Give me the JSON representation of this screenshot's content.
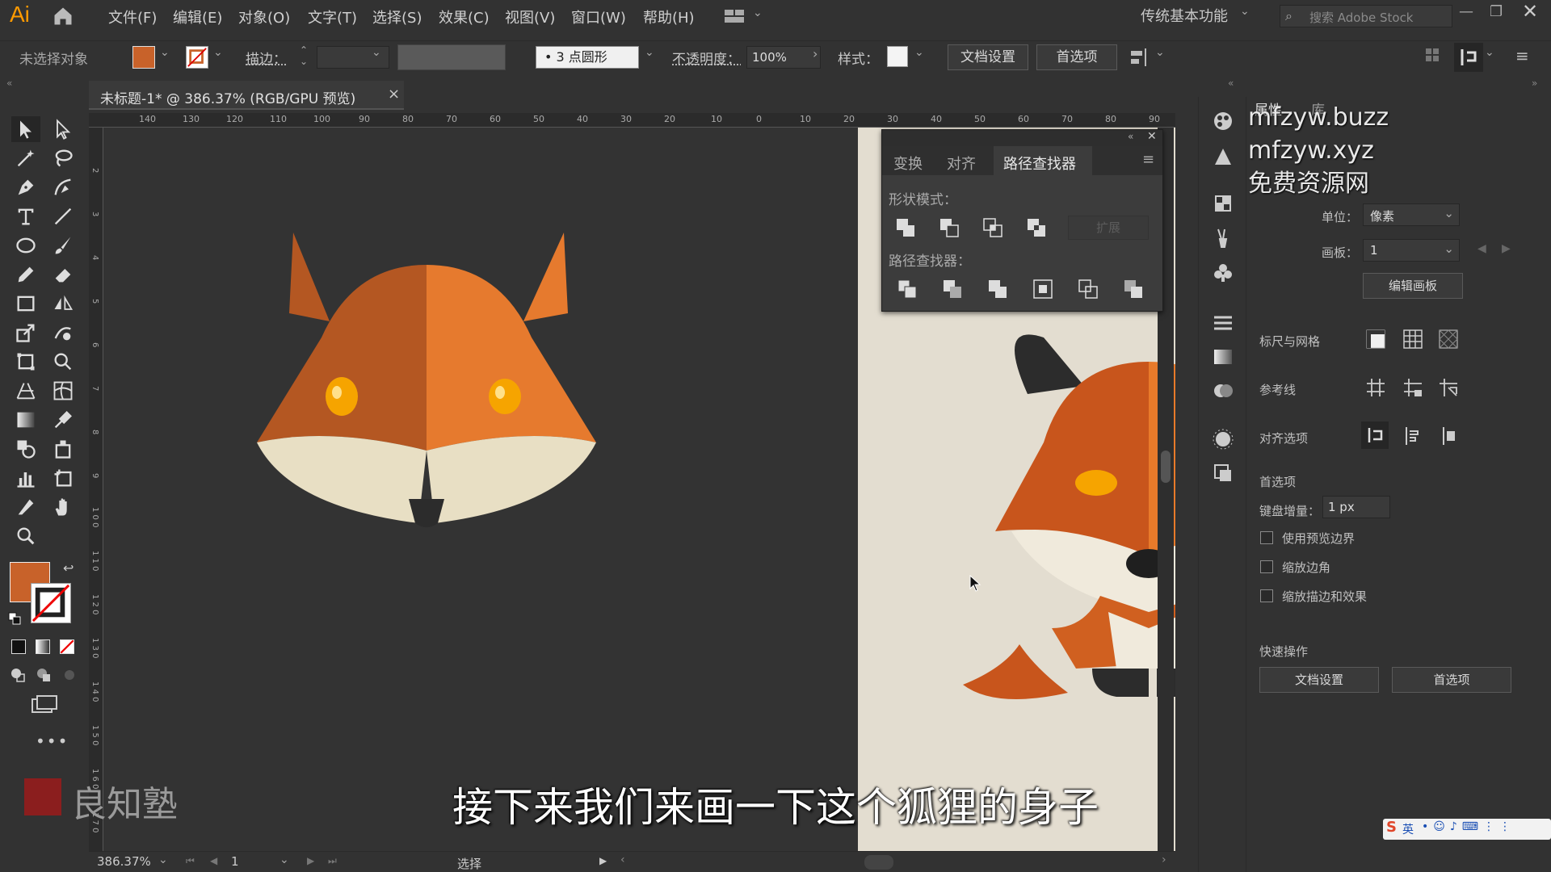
{
  "app": {
    "logo": "Ai",
    "menus": [
      "文件(F)",
      "编辑(E)",
      "对象(O)",
      "文字(T)",
      "选择(S)",
      "效果(C)",
      "视图(V)",
      "窗口(W)",
      "帮助(H)"
    ],
    "workspace": "传统基本功能",
    "search_placeholder": "搜索 Adobe Stock"
  },
  "controlbar": {
    "selection": "未选择对象",
    "stroke_label": "描边：",
    "brush": "3 点圆形",
    "opacity_label": "不透明度：",
    "opacity_value": "100%",
    "style_label": "样式：",
    "doc_setup": "文档设置",
    "prefs": "首选项"
  },
  "document": {
    "tab_title": "未标题-1* @ 386.37% (RGB/GPU 预览)",
    "close": "×"
  },
  "rulers": {
    "top": [
      "140",
      "130",
      "120",
      "110",
      "100",
      "90",
      "80",
      "70",
      "60",
      "50",
      "40",
      "30",
      "20",
      "10",
      "0",
      "10",
      "20",
      "30",
      "40",
      "50",
      "60",
      "70",
      "80",
      "90"
    ],
    "left": [
      "2",
      "3",
      "4",
      "5",
      "6",
      "7",
      "8",
      "9",
      "1 0 0",
      "1 1 0",
      "1 2 0",
      "1 3 0",
      "1 4 0",
      "1 5 0",
      "1 6 0",
      "1 7 0",
      "1 8 0"
    ]
  },
  "pathfinder": {
    "tabs": [
      "变换",
      "对齐",
      "路径查找器"
    ],
    "shape_modes_label": "形状模式：",
    "expand_label": "扩展",
    "pathfinders_label": "路径查找器："
  },
  "properties": {
    "tabs": [
      "属性",
      "库"
    ],
    "unit_label": "单位：",
    "unit_value": "像素",
    "artboard_label": "画板：",
    "artboard_value": "1",
    "edit_artboard": "编辑画板",
    "rulers_grids": "标尺与网格",
    "guides": "参考线",
    "snap_options": "对齐选项",
    "prefs_section": "首选项",
    "keyboard_increment_label": "键盘增量：",
    "keyboard_increment_value": "1 px",
    "use_preview_bounds": "使用预览边界",
    "scale_corners": "缩放边角",
    "scale_strokes": "缩放描边和效果",
    "quick_actions": "快速操作",
    "doc_setup": "文档设置",
    "prefs": "首选项"
  },
  "status": {
    "zoom": "386.37%",
    "page": "1",
    "mode": "选择"
  },
  "overlay": {
    "subtitle": "接下来我们来画一下这个狐狸的身子",
    "watermark_lines": [
      "mfzyw.buzz",
      "mfzyw.xyz",
      "免费资源网"
    ],
    "brand": "良知塾",
    "ime": "英"
  },
  "colors": {
    "fill": "#c8622a",
    "fox_dark": "#b45722",
    "fox_light": "#e67a2e",
    "fox_cream": "#e8dfc4",
    "fox_nose": "#2c2c2c",
    "fox_eye": "#f6a400",
    "artboard_bg": "#e3ddd0",
    "ui_bg": "#323232"
  }
}
